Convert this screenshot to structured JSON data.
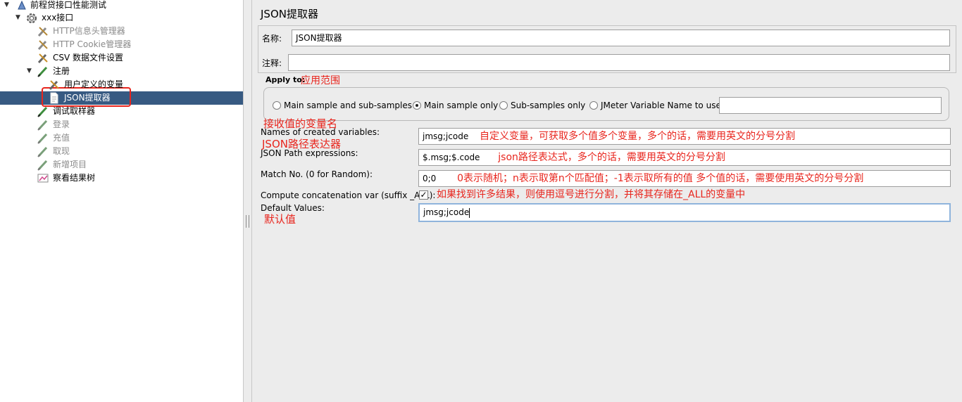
{
  "tree": {
    "root": {
      "label": "前程贷接口性能测试",
      "icon": "test-plan-icon"
    },
    "items": [
      {
        "label": "xxx接口",
        "icon": "thread-group-gear-icon",
        "disabled": false
      },
      {
        "label": "HTTP信息头管理器",
        "icon": "wrench-icon",
        "disabled": true
      },
      {
        "label": "HTTP Cookie管理器",
        "icon": "wrench-icon",
        "disabled": true
      },
      {
        "label": "CSV 数据文件设置",
        "icon": "wrench-icon",
        "disabled": false
      },
      {
        "label": "注册",
        "icon": "sampler-pen-icon",
        "disabled": false
      },
      {
        "label": "用户定义的变量",
        "icon": "wrench-icon",
        "disabled": false
      },
      {
        "label": "JSON提取器",
        "icon": "document-icon",
        "disabled": false,
        "selected": true
      },
      {
        "label": "调试取样器",
        "icon": "sampler-pen-icon",
        "disabled": false
      },
      {
        "label": "登录",
        "icon": "sampler-pen-icon",
        "disabled": true
      },
      {
        "label": "充值",
        "icon": "sampler-pen-icon",
        "disabled": true
      },
      {
        "label": "取现",
        "icon": "sampler-pen-icon",
        "disabled": true
      },
      {
        "label": "新增项目",
        "icon": "sampler-pen-icon",
        "disabled": true
      },
      {
        "label": "察看结果树",
        "icon": "results-tree-icon",
        "disabled": false
      }
    ]
  },
  "panel": {
    "title": "JSON提取器",
    "name_label": "名称:",
    "name_value": "JSON提取器",
    "comment_label": "注释:",
    "comment_value": "",
    "apply_to": {
      "label": "Apply to:",
      "annotation": "应用范围",
      "options": [
        "Main sample and sub-samples",
        "Main sample only",
        "Sub-samples only",
        "JMeter Variable Name to use"
      ],
      "selected_index": 1,
      "variable_value": ""
    },
    "fields": {
      "names_annotation": "接收值的变量名",
      "names_label": "Names of created variables:",
      "names_value": "jmsg;jcode",
      "names_note": "自定义变量，可获取多个值多个变量，多个的话，需要用英文的分号分割",
      "path_annotation": "JSON路径表达器",
      "path_label": "JSON Path expressions:",
      "path_value": "$.msg;$.code",
      "path_note": "json路径表达式，多个的话，需要用英文的分号分割",
      "match_label": "Match No. (0 for Random):",
      "match_value": "0;0",
      "match_note": "0表示随机；n表示取第n个匹配值；-1表示取所有的值 多个值的话，需要使用英文的分号分割",
      "concat_label": "Compute concatenation var (suffix _ALL):",
      "concat_checked": true,
      "concat_note": "如果找到许多结果，则使用逗号进行分割，并将其存储在_ALL的变量中",
      "default_label": "Default Values:",
      "default_annotation": "默认值",
      "default_value": "jmsg;jcode"
    }
  },
  "colors": {
    "annotation_red": "#e8251d",
    "selection_blue": "#375a82",
    "panel_bg": "#ececec"
  }
}
